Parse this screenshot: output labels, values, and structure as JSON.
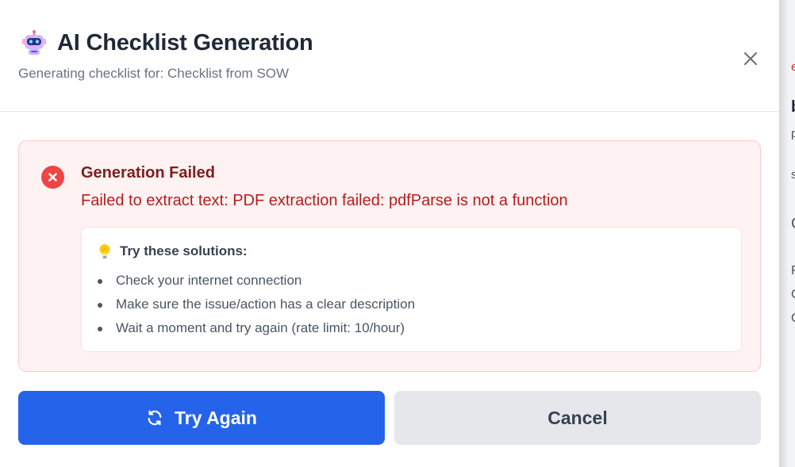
{
  "modal": {
    "icon": "robot-icon",
    "title": "AI Checklist Generation",
    "subtitle": "Generating checklist for: Checklist from SOW",
    "close_icon": "close-icon"
  },
  "error": {
    "icon": "error-x-icon",
    "title": "Generation Failed",
    "message": "Failed to extract text: PDF extraction failed: pdfParse is not a function",
    "solutions": {
      "icon": "lightbulb-icon",
      "title": "Try these solutions:",
      "items": [
        "Check your internet connection",
        "Make sure the issue/action has a clear description",
        "Wait a moment and try again (rate limit: 10/hour)"
      ]
    }
  },
  "actions": {
    "retry_icon": "refresh-icon",
    "retry_label": "Try Again",
    "cancel_label": "Cancel"
  },
  "colors": {
    "primary": "#2563eb",
    "error_bg": "#fef2f2",
    "error_border": "#fecaca",
    "error_title": "#7f1d1d",
    "error_text": "#b91c1c",
    "error_icon": "#ef4444"
  },
  "backdrop": {
    "glyphs": [
      "e",
      "b",
      "p",
      "s",
      "C",
      "F",
      "C",
      "C"
    ]
  }
}
